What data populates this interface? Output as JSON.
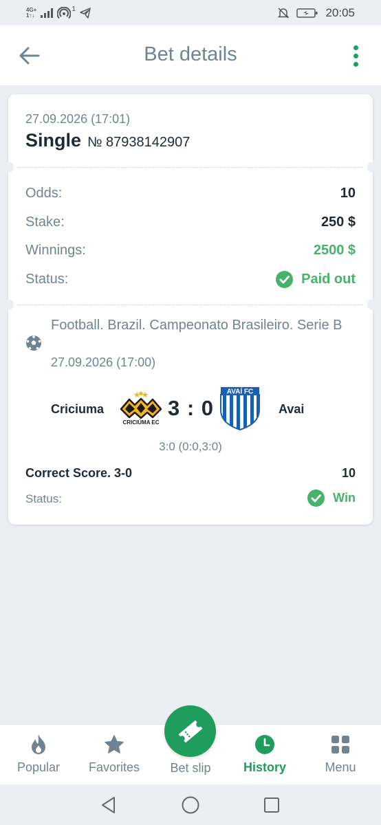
{
  "status_bar": {
    "network": "4G+",
    "data_speed": "1↑↓",
    "wifi_badge": "1",
    "time": "20:05"
  },
  "header": {
    "title": "Bet details",
    "back_icon": "arrow-left-icon",
    "menu_icon": "more-vertical-icon"
  },
  "bet": {
    "date": "27.09.2026 (17:01)",
    "type": "Single",
    "number": "№ 87938142907",
    "rows": {
      "odds": {
        "label": "Odds:",
        "value": "10"
      },
      "stake": {
        "label": "Stake:",
        "value": "250 $"
      },
      "winnings": {
        "label": "Winnings:",
        "value": "2500 $"
      },
      "status": {
        "label": "Status:",
        "value": "Paid out"
      }
    }
  },
  "event": {
    "sport_icon": "football-icon",
    "league": "Football. Brazil. Campeonato Brasileiro. Serie B",
    "date": "27.09.2026 (17:00)",
    "team1": "Criciuma",
    "team1_logo_text": "CRICIÚMA EC",
    "team2": "Avai",
    "team2_logo_text": "AVAÍ FC",
    "score": "3 : 0",
    "score_detail": "3:0 (0:0,3:0)",
    "market": "Correct Score. 3-0",
    "market_odds": "10",
    "status_label": "Status:",
    "status_value": "Win"
  },
  "bottom_nav": {
    "items": [
      {
        "label": "Popular",
        "icon": "flame-icon"
      },
      {
        "label": "Favorites",
        "icon": "star-icon"
      },
      {
        "label": "Bet slip",
        "icon": "ticket-icon"
      },
      {
        "label": "History",
        "icon": "clock-icon"
      },
      {
        "label": "Menu",
        "icon": "grid-icon"
      }
    ],
    "active": "History"
  },
  "colors": {
    "accent": "#1f9d5c",
    "success": "#45b36b",
    "muted_text": "#6f8493",
    "background": "#ebeff3",
    "criciuma_yellow": "#f2b51c",
    "avai_blue": "#1b5fb0"
  }
}
